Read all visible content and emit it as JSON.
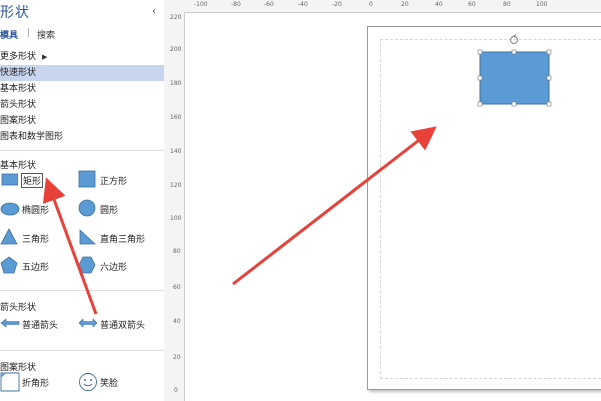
{
  "panel": {
    "title": "形状",
    "collapse_icon": "chevron-left-icon",
    "tabs": {
      "stencils": "模具",
      "separator": "|",
      "search": "搜索"
    },
    "menu": [
      "更多形状",
      "快速形状",
      "基本形状",
      "箭头形状",
      "图案形状",
      "图表和数学图形"
    ],
    "selected_menu": "快速形状"
  },
  "sections": {
    "basic": {
      "title": "基本形状",
      "shapes": [
        {
          "label": "矩形",
          "icon": "rectangle-icon"
        },
        {
          "label": "正方形",
          "icon": "square-icon"
        },
        {
          "label": "椭圆形",
          "icon": "ellipse-icon"
        },
        {
          "label": "圆形",
          "icon": "circle-icon"
        },
        {
          "label": "三角形",
          "icon": "triangle-icon"
        },
        {
          "label": "直角三角形",
          "icon": "right-triangle-icon"
        },
        {
          "label": "五边形",
          "icon": "pentagon-icon"
        },
        {
          "label": "六边形",
          "icon": "hexagon-icon"
        }
      ]
    },
    "arrows": {
      "title": "箭头形状",
      "shapes": [
        {
          "label": "普通箭头",
          "icon": "arrow-left-icon"
        },
        {
          "label": "普通双箭头",
          "icon": "double-arrow-icon"
        }
      ]
    },
    "pattern": {
      "title": "图案形状",
      "shapes": [
        {
          "label": "折角形",
          "icon": "folded-corner-icon"
        },
        {
          "label": "笑脸",
          "icon": "smiley-icon"
        }
      ]
    }
  },
  "ruler": {
    "top": [
      "-100",
      "-80",
      "-60",
      "-40",
      "-20",
      "0",
      "20",
      "40",
      "60",
      "80",
      "100"
    ],
    "left": [
      "220",
      "200",
      "180",
      "160",
      "140",
      "120",
      "100",
      "80",
      "60",
      "40",
      "20",
      "0"
    ]
  },
  "colors": {
    "shape_fill": "#5b9bd5",
    "shape_stroke": "#41719c",
    "annotation_arrow": "#e8413a",
    "selected_bg": "#c7d5ee"
  }
}
